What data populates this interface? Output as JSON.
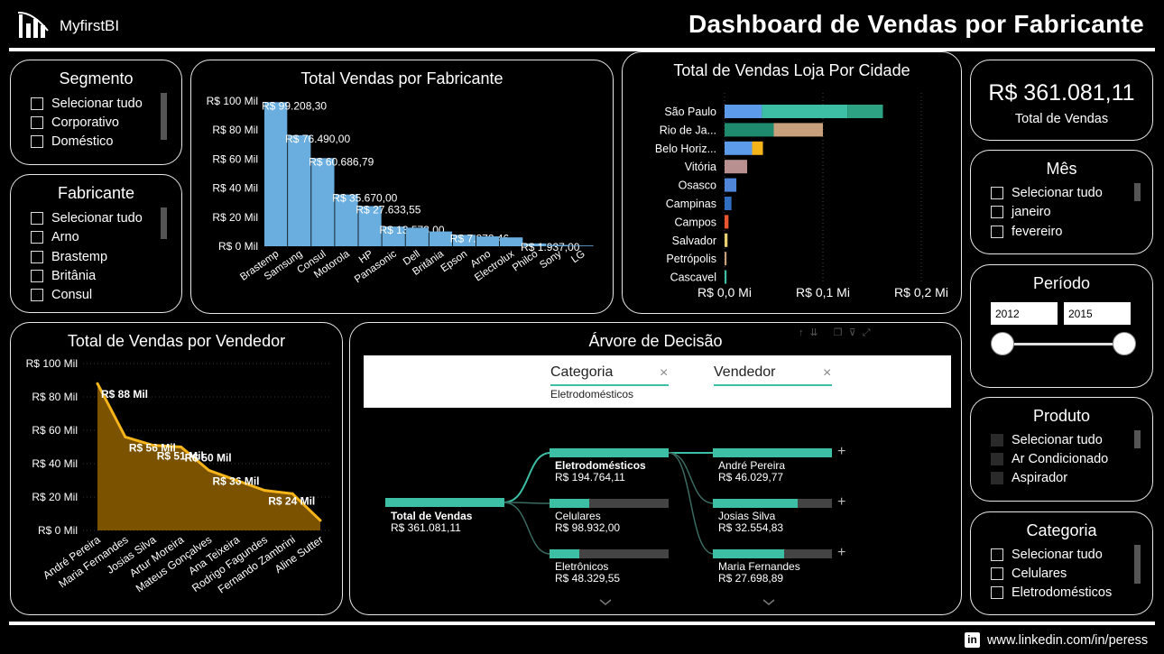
{
  "header": {
    "logo_text": "MyfirstBI",
    "title": "Dashboard de Vendas por Fabricante"
  },
  "footer": {
    "linkedin": "www.linkedin.com/in/peress"
  },
  "segmento": {
    "title": "Segmento",
    "items": [
      "Selecionar tudo",
      "Corporativo",
      "Doméstico"
    ]
  },
  "fabricante_slicer": {
    "title": "Fabricante",
    "items": [
      "Selecionar tudo",
      "Arno",
      "Brastemp",
      "Britânia",
      "Consul"
    ]
  },
  "kpi": {
    "value": "R$ 361.081,11",
    "label": "Total de Vendas"
  },
  "mes": {
    "title": "Mês",
    "items": [
      "Selecionar tudo",
      "janeiro",
      "fevereiro"
    ]
  },
  "periodo": {
    "title": "Período",
    "start": "2012",
    "end": "2015"
  },
  "produto": {
    "title": "Produto",
    "items": [
      "Selecionar tudo",
      "Ar Condicionado",
      "Aspirador"
    ]
  },
  "categoria_slicer": {
    "title": "Categoria",
    "items": [
      "Selecionar tudo",
      "Celulares",
      "Eletrodomésticos"
    ]
  },
  "fab_chart": {
    "title": "Total Vendas por Fabricante",
    "type": "bar",
    "color": "#6aaee0",
    "yticks": [
      "R$ 100 Mil",
      "R$ 80 Mil",
      "R$ 60 Mil",
      "R$ 40 Mil",
      "R$ 20 Mil",
      "R$ 0 Mil"
    ],
    "ylim": [
      0,
      100000
    ],
    "categories": [
      "Brastemp",
      "Samsung",
      "Consul",
      "Motorola",
      "HP",
      "Panasonic",
      "Dell",
      "Britânia",
      "Epson",
      "Arno",
      "Electrolux",
      "Philco",
      "Sony",
      "LG"
    ],
    "values": [
      99208.3,
      76490.0,
      60686.79,
      35670.0,
      27633.55,
      13573.0,
      12800,
      10200,
      7872.46,
      6800,
      6100,
      1937.0,
      900,
      500
    ],
    "labels": [
      "R$ 99.208,30",
      "R$ 76.490,00",
      "R$ 60.686,79",
      "R$ 35.670,00",
      "R$ 27.633,55",
      "R$ 13.573,00",
      "",
      "",
      "R$ 7.872,46",
      "",
      "",
      "R$ 1.937,00",
      "",
      ""
    ]
  },
  "city_chart": {
    "title": "Total de Vendas Loja Por Cidade",
    "type": "bar",
    "xticks": [
      "R$ 0,0 Mi",
      "R$ 0,1 Mi",
      "R$ 0,2 Mi"
    ],
    "xlim": [
      0,
      0.2
    ],
    "categories": [
      "São Paulo",
      "Rio de Ja...",
      "Belo Horiz...",
      "Vitória",
      "Osasco",
      "Campinas",
      "Campos",
      "Salvador",
      "Petrópolis",
      "Cascavel"
    ],
    "segments": [
      [
        {
          "value": 0.038,
          "color": "#5b9bea"
        },
        {
          "value": 0.087,
          "color": "#3dbfa6"
        },
        {
          "value": 0.036,
          "color": "#2ea383"
        }
      ],
      [
        {
          "value": 0.05,
          "color": "#1e8a6e"
        },
        {
          "value": 0.05,
          "color": "#c8a07c"
        }
      ],
      [
        {
          "value": 0.028,
          "color": "#5b9bea"
        },
        {
          "value": 0.011,
          "color": "#f5b41a"
        }
      ],
      [
        {
          "value": 0.023,
          "color": "#b89090"
        }
      ],
      [
        {
          "value": 0.012,
          "color": "#4f86d9"
        }
      ],
      [
        {
          "value": 0.007,
          "color": "#2f6ec0"
        }
      ],
      [
        {
          "value": 0.004,
          "color": "#e8552e"
        }
      ],
      [
        {
          "value": 0.003,
          "color": "#e8d070"
        }
      ],
      [
        {
          "value": 0.002,
          "color": "#c8a07c"
        }
      ],
      [
        {
          "value": 0.002,
          "color": "#3dbfa6"
        }
      ]
    ]
  },
  "vend_chart": {
    "title": "Total de Vendas por Vendedor",
    "type": "area",
    "line_color": "#f5b41a",
    "fill_color": "#7a5200",
    "yticks": [
      "R$ 100 Mil",
      "R$ 80 Mil",
      "R$ 60 Mil",
      "R$ 40 Mil",
      "R$ 20 Mil",
      "R$ 0 Mil"
    ],
    "ylim": [
      0,
      100000
    ],
    "categories": [
      "André Pereira",
      "Maria Fernandes",
      "Josias Silva",
      "Artur Moreira",
      "Mateus Gonçalves",
      "Ana Teixeira",
      "Rodrigo Fagundes",
      "Fernando Zambrini",
      "Aline Sutter"
    ],
    "values": [
      88000,
      56000,
      51000,
      50000,
      36000,
      30000,
      24000,
      22000,
      6000
    ],
    "labels": [
      "R$ 88 Mil",
      "R$ 56 Mil",
      "R$ 51 Mil",
      "R$ 50 Mil",
      "R$ 36 Mil",
      "",
      "R$ 24 Mil",
      "",
      ""
    ]
  },
  "tree": {
    "title": "Árvore de Decisão",
    "filter1_label": "Categoria",
    "filter1_value": "Eletrodomésticos",
    "filter2_label": "Vendedor",
    "remove_icon": "×",
    "expand_icon": "+",
    "root": {
      "name": "Total de Vendas",
      "value": "R$ 361.081,11"
    },
    "level1": [
      {
        "name": "Eletrodomésticos",
        "value": "R$ 194.764,11",
        "fraction": 1.0
      },
      {
        "name": "Celulares",
        "value": "R$ 98.932,00",
        "fraction": 0.33
      },
      {
        "name": "Eletrônicos",
        "value": "R$ 48.329,55",
        "fraction": 0.25
      }
    ],
    "level2": [
      {
        "name": "André Pereira",
        "value": "R$ 46.029,77",
        "fraction": 1.0
      },
      {
        "name": "Josias Silva",
        "value": "R$ 32.554,83",
        "fraction": 0.71
      },
      {
        "name": "Maria Fernandes",
        "value": "R$ 27.698,89",
        "fraction": 0.6
      }
    ],
    "accent": "#3dbfa6"
  }
}
